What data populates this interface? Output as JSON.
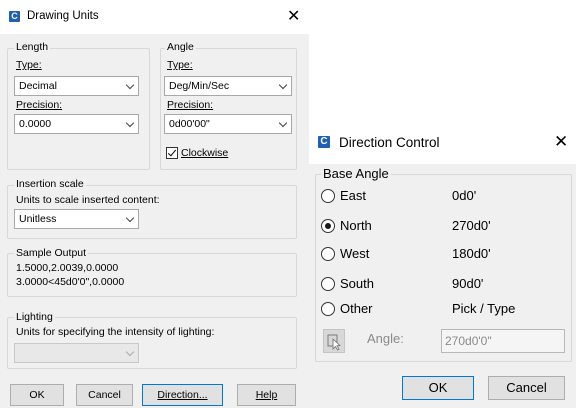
{
  "drawing_units": {
    "title": "Drawing Units",
    "app_icon": "C",
    "length": {
      "group_label": "Length",
      "type_label": "Type:",
      "type_value": "Decimal",
      "precision_label": "Precision:",
      "precision_value": "0.0000"
    },
    "angle": {
      "group_label": "Angle",
      "type_label": "Type:",
      "type_value": "Deg/Min/Sec",
      "precision_label": "Precision:",
      "precision_value": "0d00'00\"",
      "clockwise_label": "Clockwise",
      "clockwise_checked": true
    },
    "insertion": {
      "group_label": "Insertion scale",
      "desc": "Units to scale inserted content:",
      "value": "Unitless"
    },
    "sample": {
      "group_label": "Sample Output",
      "line1": "1.5000,2.0039,0.0000",
      "line2": "3.0000<45d0'0\",0.0000"
    },
    "lighting": {
      "group_label": "Lighting",
      "desc": "Units for specifying the intensity of lighting:",
      "value": ""
    },
    "buttons": {
      "ok": "OK",
      "cancel": "Cancel",
      "direction": "Direction...",
      "help": "Help"
    }
  },
  "direction_control": {
    "title": "Direction Control",
    "app_icon": "C",
    "group_label": "Base Angle",
    "options": [
      {
        "label": "East",
        "value": "0d0'",
        "selected": false
      },
      {
        "label": "North",
        "value": "270d0'",
        "selected": true
      },
      {
        "label": "West",
        "value": "180d0'",
        "selected": false
      },
      {
        "label": "South",
        "value": "90d0'",
        "selected": false
      },
      {
        "label": "Other",
        "value": "Pick / Type",
        "selected": false
      }
    ],
    "angle_label": "Angle:",
    "angle_value": "270d0'0\"",
    "ok": "OK",
    "cancel": "Cancel"
  },
  "icons": {
    "app": "autocad-c-icon",
    "close": "close-icon",
    "dropdown": "chevron-down-icon",
    "pick": "pick-point-icon"
  }
}
